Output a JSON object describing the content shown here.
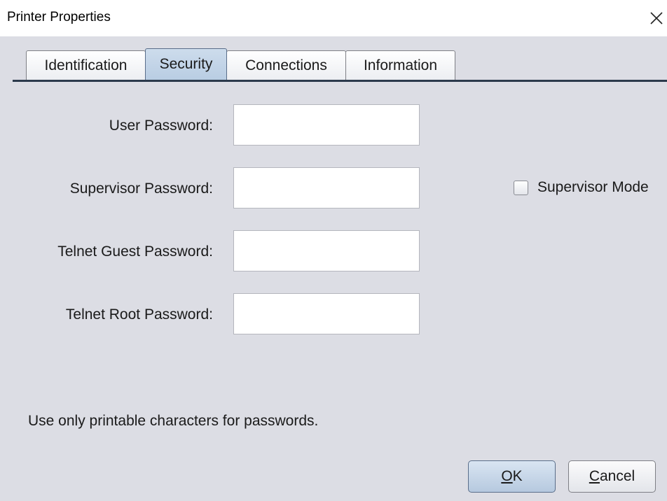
{
  "window": {
    "title": "Printer Properties",
    "close_icon": "close-icon"
  },
  "tabs": [
    {
      "label": "Identification",
      "active": false
    },
    {
      "label": "Security",
      "active": true
    },
    {
      "label": "Connections",
      "active": false
    },
    {
      "label": "Information",
      "active": false
    }
  ],
  "security": {
    "fields": [
      {
        "label": "User Password:",
        "value": ""
      },
      {
        "label": "Supervisor Password:",
        "value": ""
      },
      {
        "label": "Telnet Guest Password:",
        "value": ""
      },
      {
        "label": "Telnet Root Password:",
        "value": ""
      }
    ],
    "supervisor_mode": {
      "label": "Supervisor Mode",
      "checked": false
    },
    "hint": "Use only printable characters for passwords."
  },
  "buttons": {
    "ok": {
      "mnemonic": "O",
      "rest": "K"
    },
    "cancel": {
      "mnemonic": "C",
      "rest": "ancel"
    }
  },
  "colors": {
    "background": "#dcdde4",
    "active_tab": "#c3d5ea",
    "tab_line": "#2c3a4c"
  }
}
